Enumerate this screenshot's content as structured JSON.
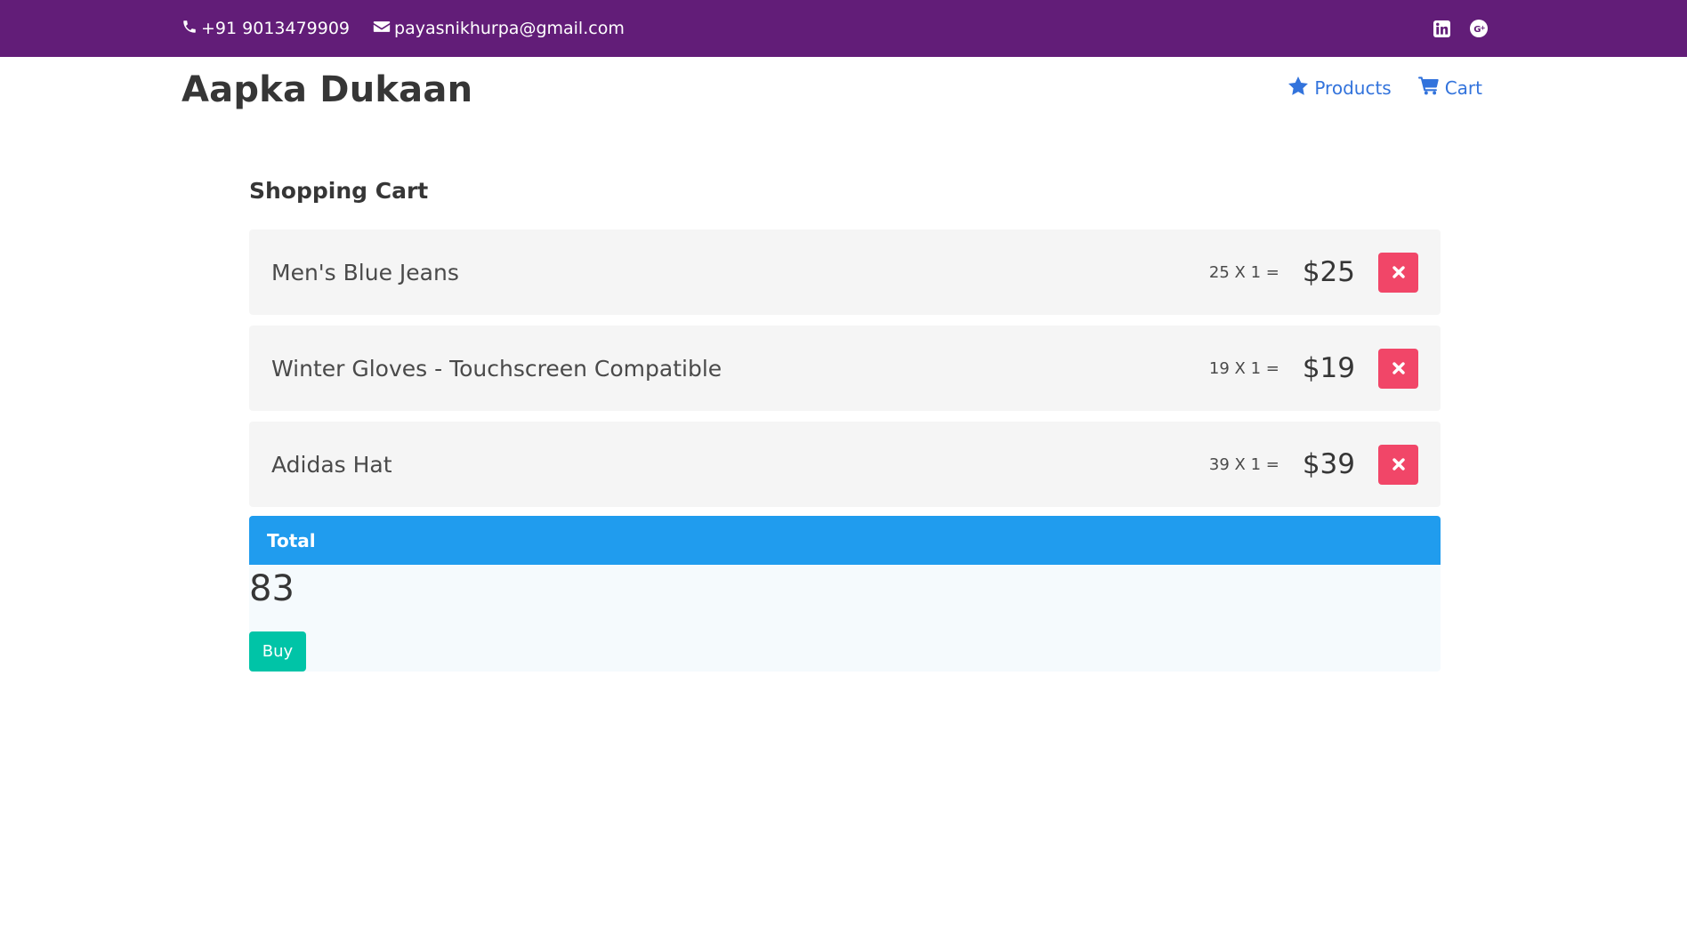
{
  "topbar": {
    "phone": "+91 9013479909",
    "email": "payasnikhurpa@gmail.com",
    "icons": [
      "phone-icon",
      "envelope-icon",
      "linkedin-icon",
      "google-plus-icon"
    ],
    "bg_color": "#621d78"
  },
  "header": {
    "brand": "Aapka Dukaan",
    "nav": [
      {
        "label": "Products",
        "icon": "star-icon"
      },
      {
        "label": "Cart",
        "icon": "cart-icon"
      }
    ],
    "link_color": "#3273dc"
  },
  "cart": {
    "title": "Shopping Cart",
    "items": [
      {
        "name": "Men's Blue Jeans",
        "qty_text": "25 X 1 =",
        "price": "$25"
      },
      {
        "name": "Winter Gloves - Touchscreen Compatible",
        "qty_text": "19 X 1 =",
        "price": "$19"
      },
      {
        "name": "Adidas Hat",
        "qty_text": "39 X 1 =",
        "price": "$39"
      }
    ],
    "remove_icon": "close-icon",
    "remove_color": "#f14668"
  },
  "total": {
    "label": "Total",
    "value": "83",
    "buy_label": "Buy",
    "header_color": "#209cee",
    "buy_color": "#00c4a7"
  }
}
